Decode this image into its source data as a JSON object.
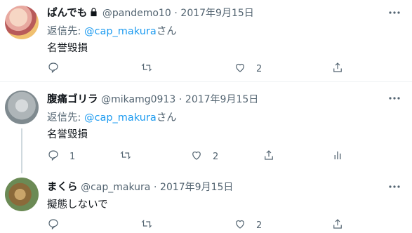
{
  "tweets": [
    {
      "name": "ぱんでも",
      "handle": "@pandemo10",
      "dot": "·",
      "date": "2017年9月15日",
      "reply_prefix": "返信先: ",
      "reply_handle": "@cap_makura",
      "reply_suffix": "さん",
      "text": "名誉毀損",
      "reply_count": "",
      "retweet_count": "",
      "like_count": "2"
    },
    {
      "name": "腹痛ゴリラ",
      "handle": "@mikamg0913",
      "dot": "·",
      "date": "2017年9月15日",
      "reply_prefix": "返信先: ",
      "reply_handle": "@cap_makura",
      "reply_suffix": "さん",
      "text": "名誉毀損",
      "reply_count": "1",
      "retweet_count": "",
      "like_count": "2"
    },
    {
      "name": "まくら",
      "handle": "@cap_makura",
      "dot": "·",
      "date": "2017年9月15日",
      "text": "擬態しないで",
      "reply_count": "",
      "retweet_count": "",
      "like_count": "2"
    }
  ],
  "icons": [
    "lock-icon",
    "more-icon",
    "reply-icon",
    "retweet-icon",
    "like-icon",
    "share-icon",
    "analytics-icon"
  ],
  "colors": {
    "link": "#1d9bf0",
    "muted": "#536471",
    "text": "#0f1419",
    "divider": "#eff3f4"
  }
}
